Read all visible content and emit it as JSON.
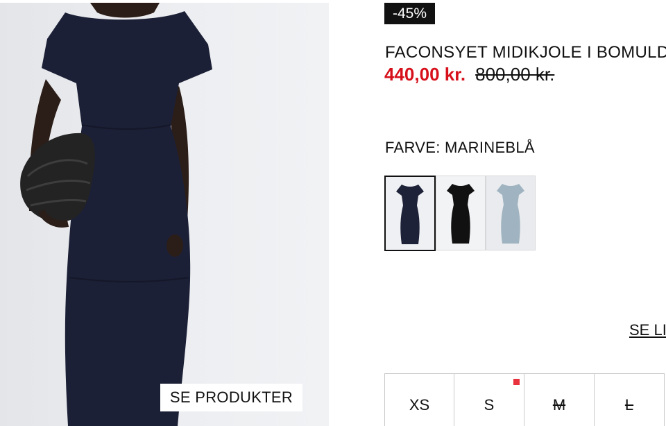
{
  "product": {
    "discount_badge": "-45%",
    "title": "FACONSYET MIDIKJOLE I BOMULD",
    "sale_price": "440,00 kr.",
    "original_price": "800,00 kr."
  },
  "photo": {
    "shop_products_label": "SE PRODUKTER",
    "background_color": "#e9eaed",
    "dress_color": "#1c2036"
  },
  "colors": {
    "label": "FARVE: MARINEBLÅ",
    "swatches": [
      {
        "name": "navy",
        "color": "#1d2238",
        "selected": true
      },
      {
        "name": "black",
        "color": "#111111",
        "selected": false
      },
      {
        "name": "light-blue",
        "color": "#9fb3c0",
        "selected": false
      }
    ]
  },
  "size_guide": {
    "label": "SE LIGNENDE"
  },
  "sizes": [
    {
      "label": "XS",
      "available": true,
      "low_stock": false
    },
    {
      "label": "S",
      "available": true,
      "low_stock": true
    },
    {
      "label": "M",
      "available": false,
      "low_stock": false
    },
    {
      "label": "L",
      "available": false,
      "low_stock": false
    }
  ],
  "theme": {
    "sale_color": "#d6111b",
    "low_stock_color": "#e8323e",
    "badge_color": "#111111"
  }
}
